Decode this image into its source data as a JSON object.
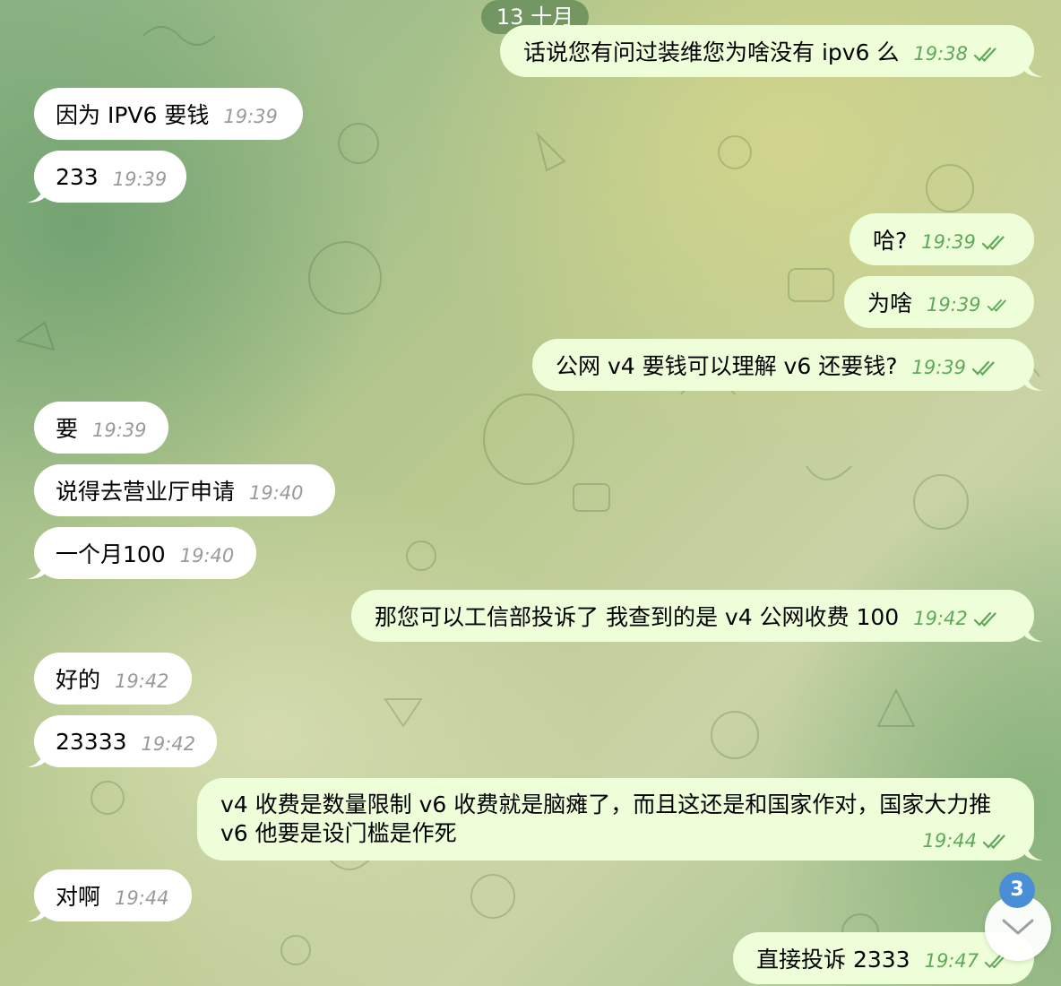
{
  "date_label": "13 十月",
  "messages": [
    {
      "dir": "out",
      "text": "话说您有问过装维您为啥没有 ipv6 么",
      "time": "19:38"
    },
    {
      "dir": "in",
      "text": "因为 IPV6 要钱",
      "time": "19:39"
    },
    {
      "dir": "in",
      "text": "233",
      "time": "19:39"
    },
    {
      "dir": "out",
      "text": "哈?",
      "time": "19:39"
    },
    {
      "dir": "out",
      "text": "为啥",
      "time": "19:39"
    },
    {
      "dir": "out",
      "text": "公网 v4 要钱可以理解 v6 还要钱?",
      "time": "19:39"
    },
    {
      "dir": "in",
      "text": "要",
      "time": "19:39"
    },
    {
      "dir": "in",
      "text": "说得去营业厅申请",
      "time": "19:40"
    },
    {
      "dir": "in",
      "text": "一个月100",
      "time": "19:40"
    },
    {
      "dir": "out",
      "text": "那您可以工信部投诉了 我查到的是 v4 公网收费 100",
      "time": "19:42"
    },
    {
      "dir": "in",
      "text": "好的",
      "time": "19:42"
    },
    {
      "dir": "in",
      "text": "23333",
      "time": "19:42"
    },
    {
      "dir": "out",
      "text": "v4 收费是数量限制 v6 收费就是脑瘫了，而且这还是和国家作对，国家大力推 v6 他要是设门槛是作死",
      "time": "19:44"
    },
    {
      "dir": "in",
      "text": "对啊",
      "time": "19:44"
    },
    {
      "dir": "out",
      "text": "直接投诉 2333",
      "time": "19:47"
    }
  ],
  "unread_count": "3",
  "icons": {
    "read_receipt": "double-check-icon",
    "scroll_down": "chevron-down-icon"
  },
  "colors": {
    "incoming_bubble": "#ffffff",
    "outgoing_bubble": "#eefed9",
    "time_out": "#5fa85a",
    "badge": "#4a8fd6"
  }
}
